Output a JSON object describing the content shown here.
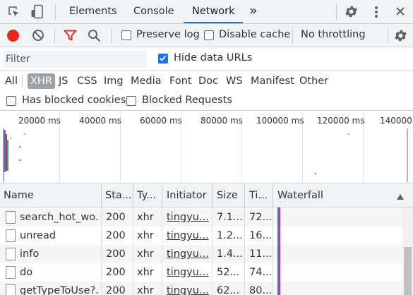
{
  "tabs": {
    "items": [
      "Elements",
      "Console",
      "Network"
    ],
    "active": "Network",
    "more": "»"
  },
  "toolbar": {
    "preserve_log": "Preserve log",
    "disable_cache": "Disable cache",
    "throttling": "No throttling",
    "preserve_log_checked": false,
    "disable_cache_checked": false
  },
  "filter": {
    "placeholder": "Filter",
    "hide_data_urls": "Hide data URLs",
    "hide_data_urls_checked": true
  },
  "types": [
    "All",
    "XHR",
    "JS",
    "CSS",
    "Img",
    "Media",
    "Font",
    "Doc",
    "WS",
    "Manifest",
    "Other"
  ],
  "selected_type": "XHR",
  "blocked": {
    "has_blocked_cookies": "Has blocked cookies",
    "blocked_requests": "Blocked Requests"
  },
  "overview": {
    "ticks": [
      "20000 ms",
      "40000 ms",
      "60000 ms",
      "80000 ms",
      "100000 ms",
      "120000 ms",
      "140000"
    ]
  },
  "table": {
    "headers": [
      "Name",
      "Sta...",
      "Ty...",
      "Initiator",
      "Size",
      "Ti...",
      "Waterfall"
    ],
    "rows": [
      {
        "name": "search_hot_wo...",
        "status": "200",
        "type": "xhr",
        "initiator": "tingyu...",
        "size": "7.1...",
        "time": "72..."
      },
      {
        "name": "unread",
        "status": "200",
        "type": "xhr",
        "initiator": "tingyu...",
        "size": "1.2...",
        "time": "16..."
      },
      {
        "name": "info",
        "status": "200",
        "type": "xhr",
        "initiator": "tingyu...",
        "size": "1.4...",
        "time": "11..."
      },
      {
        "name": "do",
        "status": "200",
        "type": "xhr",
        "initiator": "tingyu...",
        "size": "52...",
        "time": "74..."
      },
      {
        "name": "getTypeToUse?...",
        "status": "200",
        "type": "xhr",
        "initiator": "tingyu...",
        "size": "62...",
        "time": "80..."
      }
    ]
  },
  "colors": {
    "record": "#e8271c",
    "filter_funnel": "#d93025",
    "accent": "#1a73e8",
    "waterfall_bar": "#5b6ad0"
  }
}
